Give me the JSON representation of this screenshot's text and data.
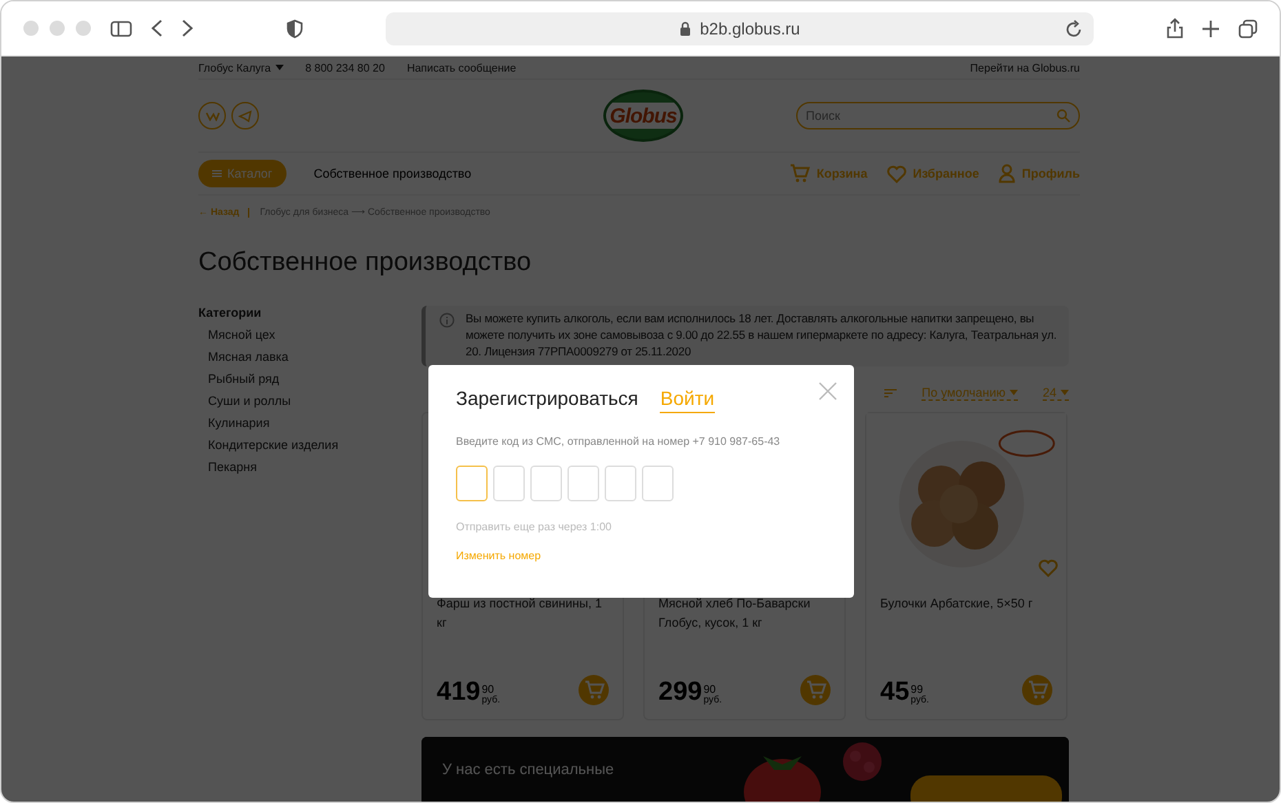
{
  "browser": {
    "url": "b2b.globus.ru"
  },
  "topbar": {
    "city": "Глобус Калуга",
    "phone": "8 800 234 80 20",
    "message_link": "Написать сообщение",
    "site_link": "Перейти на Globus.ru"
  },
  "header": {
    "logo": "Globus",
    "search": {
      "placeholder": "Поиск"
    }
  },
  "nav": {
    "catalog_button": "Каталог",
    "section": "Собственное производство",
    "actions": [
      {
        "kind": "cart",
        "label": "Корзина"
      },
      {
        "kind": "heart",
        "label": "Избранное"
      },
      {
        "kind": "profile",
        "label": "Профиль"
      }
    ]
  },
  "breadcrumb": {
    "back": "← Назад",
    "path": "Глобус для бизнеса ⟶ Собственное производство"
  },
  "page_title": "Собственное производство",
  "sidebar": {
    "title": "Категории",
    "items": [
      "Мясной цех",
      "Мясная лавка",
      "Рыбный ряд",
      "Суши и роллы",
      "Кулинария",
      "Кондитерские изделия",
      "Пекарня"
    ]
  },
  "notice": "Вы можете купить алкоголь, если вам исполнилось 18 лет. Доставлять алкогольные напитки запрещено, вы можете получить их зоне самовывоза с 9.00 до 22.55 в нашем гипермаркете по адресу: Калуга, Театральная ул. 20. Лицензия 77РПА0009279 от 25.11.2020",
  "sorting": {
    "order": "По умолчанию",
    "per_page": "24"
  },
  "products": [
    {
      "name": "Фарш из постной свинины, 1 кг",
      "price": "419",
      "kopecks": "90",
      "currency": "руб."
    },
    {
      "name": "Мясной хлеб По-Баварски Глобус, кусок, 1 кг",
      "price": "299",
      "kopecks": "90",
      "currency": "руб."
    },
    {
      "name": "Булочки Арбатские, 5×50 г",
      "price": "45",
      "kopecks": "99",
      "currency": "руб."
    }
  ],
  "banner": {
    "text": "У нас есть специальные"
  },
  "modal": {
    "tabs": [
      {
        "label": "Зарегистрироваться",
        "selected": false
      },
      {
        "label": "Войти",
        "selected": true
      }
    ],
    "hint": "Введите код из СМС, отправленной на номер +7 910 987-65-43",
    "code_cells": [
      {
        "focused": true
      },
      {
        "focused": false
      },
      {
        "focused": false
      },
      {
        "focused": false
      },
      {
        "focused": false
      },
      {
        "focused": false
      }
    ],
    "resend": "Отправить еще раз через 1:00",
    "change_link": "Изменить номер"
  }
}
